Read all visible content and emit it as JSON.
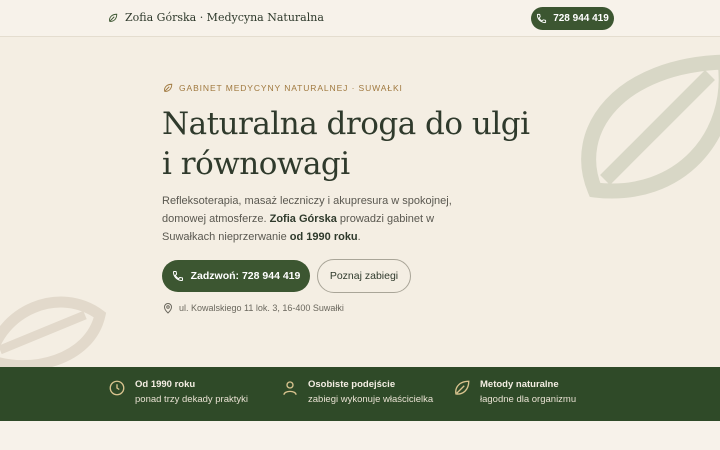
{
  "header": {
    "brand": "Zofia Górska · Medycyna Naturalna",
    "phone": "728 944 419"
  },
  "hero": {
    "eyebrow": "GABINET MEDYCYNY NATURALNEJ · SUWAŁKI",
    "title_line1": "Naturalna droga do ulgi",
    "title_line2": "i równowagi",
    "desc_part1": "Refleksoterapia, masaż leczniczy i akupresura w spokojnej, domowej atmosferze. ",
    "desc_name": "Zofia Górska",
    "desc_part2": " prowadzi gabinet w Suwałkach nieprzerwanie ",
    "desc_since": "od 1990 roku",
    "desc_end": ".",
    "cta_call": "Zadzwoń: 728 944 419",
    "cta_services": "Poznaj zabiegi",
    "address": "ul. Kowalskiego 11 lok. 3, 16-400 Suwałki"
  },
  "features": [
    {
      "title": "Od 1990 roku",
      "subtitle": "ponad trzy dekady praktyki",
      "icon": "clock-icon"
    },
    {
      "title": "Osobiste podejście",
      "subtitle": "zabiegi wykonuje właścicielka",
      "icon": "person-icon"
    },
    {
      "title": "Metody naturalne",
      "subtitle": "łagodne dla organizmu",
      "icon": "leaf-icon"
    }
  ],
  "colors": {
    "background": "#f4eee3",
    "accent_green": "#3c5631",
    "band_green": "#2f4a28",
    "eyebrow_gold": "#a0793f"
  }
}
